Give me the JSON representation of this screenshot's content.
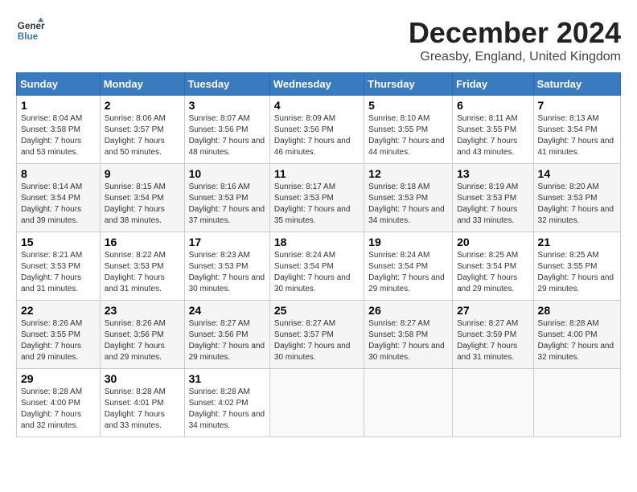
{
  "header": {
    "logo_line1": "General",
    "logo_line2": "Blue",
    "month_title": "December 2024",
    "location": "Greasby, England, United Kingdom"
  },
  "weekdays": [
    "Sunday",
    "Monday",
    "Tuesday",
    "Wednesday",
    "Thursday",
    "Friday",
    "Saturday"
  ],
  "weeks": [
    [
      {
        "day": "1",
        "sunrise": "Sunrise: 8:04 AM",
        "sunset": "Sunset: 3:58 PM",
        "daylight": "Daylight: 7 hours and 53 minutes."
      },
      {
        "day": "2",
        "sunrise": "Sunrise: 8:06 AM",
        "sunset": "Sunset: 3:57 PM",
        "daylight": "Daylight: 7 hours and 50 minutes."
      },
      {
        "day": "3",
        "sunrise": "Sunrise: 8:07 AM",
        "sunset": "Sunset: 3:56 PM",
        "daylight": "Daylight: 7 hours and 48 minutes."
      },
      {
        "day": "4",
        "sunrise": "Sunrise: 8:09 AM",
        "sunset": "Sunset: 3:56 PM",
        "daylight": "Daylight: 7 hours and 46 minutes."
      },
      {
        "day": "5",
        "sunrise": "Sunrise: 8:10 AM",
        "sunset": "Sunset: 3:55 PM",
        "daylight": "Daylight: 7 hours and 44 minutes."
      },
      {
        "day": "6",
        "sunrise": "Sunrise: 8:11 AM",
        "sunset": "Sunset: 3:55 PM",
        "daylight": "Daylight: 7 hours and 43 minutes."
      },
      {
        "day": "7",
        "sunrise": "Sunrise: 8:13 AM",
        "sunset": "Sunset: 3:54 PM",
        "daylight": "Daylight: 7 hours and 41 minutes."
      }
    ],
    [
      {
        "day": "8",
        "sunrise": "Sunrise: 8:14 AM",
        "sunset": "Sunset: 3:54 PM",
        "daylight": "Daylight: 7 hours and 39 minutes."
      },
      {
        "day": "9",
        "sunrise": "Sunrise: 8:15 AM",
        "sunset": "Sunset: 3:54 PM",
        "daylight": "Daylight: 7 hours and 38 minutes."
      },
      {
        "day": "10",
        "sunrise": "Sunrise: 8:16 AM",
        "sunset": "Sunset: 3:53 PM",
        "daylight": "Daylight: 7 hours and 37 minutes."
      },
      {
        "day": "11",
        "sunrise": "Sunrise: 8:17 AM",
        "sunset": "Sunset: 3:53 PM",
        "daylight": "Daylight: 7 hours and 35 minutes."
      },
      {
        "day": "12",
        "sunrise": "Sunrise: 8:18 AM",
        "sunset": "Sunset: 3:53 PM",
        "daylight": "Daylight: 7 hours and 34 minutes."
      },
      {
        "day": "13",
        "sunrise": "Sunrise: 8:19 AM",
        "sunset": "Sunset: 3:53 PM",
        "daylight": "Daylight: 7 hours and 33 minutes."
      },
      {
        "day": "14",
        "sunrise": "Sunrise: 8:20 AM",
        "sunset": "Sunset: 3:53 PM",
        "daylight": "Daylight: 7 hours and 32 minutes."
      }
    ],
    [
      {
        "day": "15",
        "sunrise": "Sunrise: 8:21 AM",
        "sunset": "Sunset: 3:53 PM",
        "daylight": "Daylight: 7 hours and 31 minutes."
      },
      {
        "day": "16",
        "sunrise": "Sunrise: 8:22 AM",
        "sunset": "Sunset: 3:53 PM",
        "daylight": "Daylight: 7 hours and 31 minutes."
      },
      {
        "day": "17",
        "sunrise": "Sunrise: 8:23 AM",
        "sunset": "Sunset: 3:53 PM",
        "daylight": "Daylight: 7 hours and 30 minutes."
      },
      {
        "day": "18",
        "sunrise": "Sunrise: 8:24 AM",
        "sunset": "Sunset: 3:54 PM",
        "daylight": "Daylight: 7 hours and 30 minutes."
      },
      {
        "day": "19",
        "sunrise": "Sunrise: 8:24 AM",
        "sunset": "Sunset: 3:54 PM",
        "daylight": "Daylight: 7 hours and 29 minutes."
      },
      {
        "day": "20",
        "sunrise": "Sunrise: 8:25 AM",
        "sunset": "Sunset: 3:54 PM",
        "daylight": "Daylight: 7 hours and 29 minutes."
      },
      {
        "day": "21",
        "sunrise": "Sunrise: 8:25 AM",
        "sunset": "Sunset: 3:55 PM",
        "daylight": "Daylight: 7 hours and 29 minutes."
      }
    ],
    [
      {
        "day": "22",
        "sunrise": "Sunrise: 8:26 AM",
        "sunset": "Sunset: 3:55 PM",
        "daylight": "Daylight: 7 hours and 29 minutes."
      },
      {
        "day": "23",
        "sunrise": "Sunrise: 8:26 AM",
        "sunset": "Sunset: 3:56 PM",
        "daylight": "Daylight: 7 hours and 29 minutes."
      },
      {
        "day": "24",
        "sunrise": "Sunrise: 8:27 AM",
        "sunset": "Sunset: 3:56 PM",
        "daylight": "Daylight: 7 hours and 29 minutes."
      },
      {
        "day": "25",
        "sunrise": "Sunrise: 8:27 AM",
        "sunset": "Sunset: 3:57 PM",
        "daylight": "Daylight: 7 hours and 30 minutes."
      },
      {
        "day": "26",
        "sunrise": "Sunrise: 8:27 AM",
        "sunset": "Sunset: 3:58 PM",
        "daylight": "Daylight: 7 hours and 30 minutes."
      },
      {
        "day": "27",
        "sunrise": "Sunrise: 8:27 AM",
        "sunset": "Sunset: 3:59 PM",
        "daylight": "Daylight: 7 hours and 31 minutes."
      },
      {
        "day": "28",
        "sunrise": "Sunrise: 8:28 AM",
        "sunset": "Sunset: 4:00 PM",
        "daylight": "Daylight: 7 hours and 32 minutes."
      }
    ],
    [
      {
        "day": "29",
        "sunrise": "Sunrise: 8:28 AM",
        "sunset": "Sunset: 4:00 PM",
        "daylight": "Daylight: 7 hours and 32 minutes."
      },
      {
        "day": "30",
        "sunrise": "Sunrise: 8:28 AM",
        "sunset": "Sunset: 4:01 PM",
        "daylight": "Daylight: 7 hours and 33 minutes."
      },
      {
        "day": "31",
        "sunrise": "Sunrise: 8:28 AM",
        "sunset": "Sunset: 4:02 PM",
        "daylight": "Daylight: 7 hours and 34 minutes."
      },
      null,
      null,
      null,
      null
    ]
  ]
}
